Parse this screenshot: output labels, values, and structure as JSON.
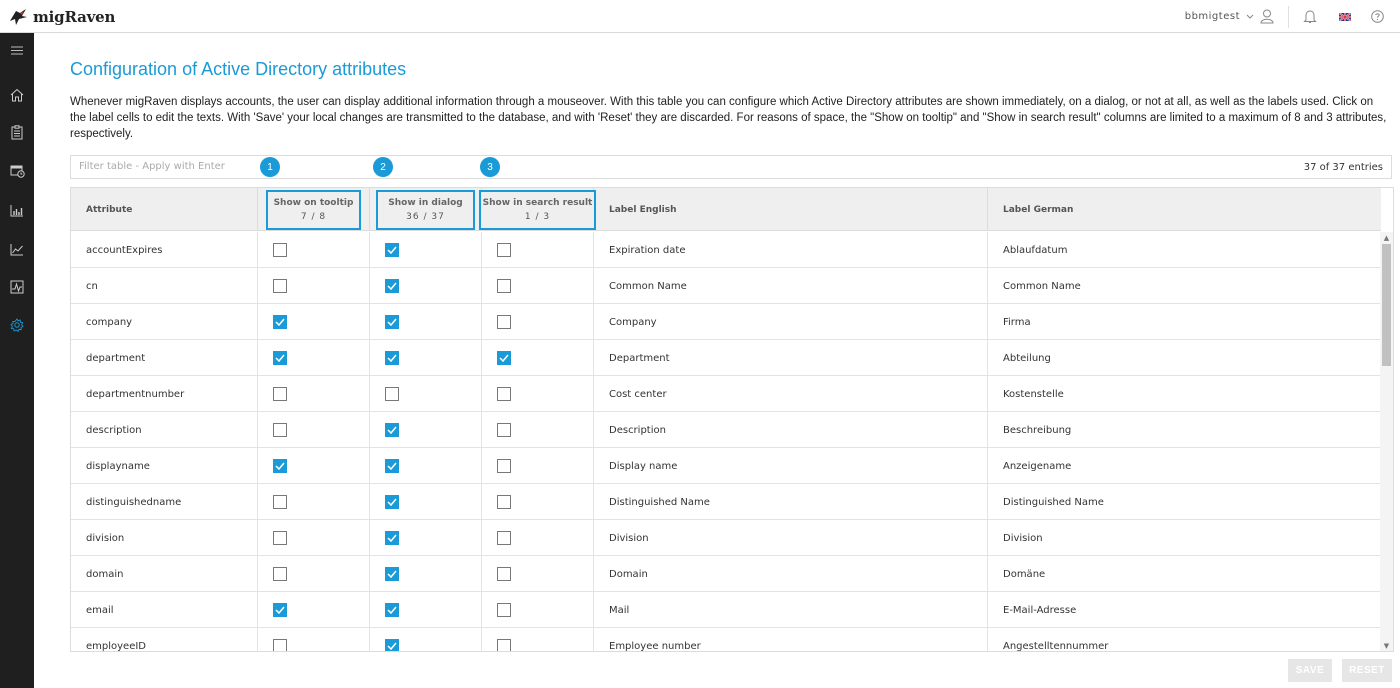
{
  "app": {
    "name": "migRaven"
  },
  "header": {
    "user": "bbmigtest"
  },
  "page": {
    "title": "Configuration of Active Directory attributes",
    "description": "Whenever migRaven displays accounts, the user can display additional information through a mouseover. With this table you can configure which Active Directory attributes are shown immediately, on a dialog, or not at all, as well as the labels used. Click on the label cells to edit the texts. With 'Save' your local changes are transmitted to the database, and with 'Reset' they are discarded. For reasons of space, the \"Show on tooltip\" and \"Show in search result\" columns are limited to a maximum of 8 and 3 attributes, respectively."
  },
  "filter": {
    "placeholder": "Filter table - Apply with Enter",
    "entries": "37 of 37 entries"
  },
  "badges": [
    "1",
    "2",
    "3"
  ],
  "columns": {
    "attribute": "Attribute",
    "tooltip": {
      "label": "Show on tooltip",
      "count": "7 / 8"
    },
    "dialog": {
      "label": "Show in dialog",
      "count": "36 / 37"
    },
    "search": {
      "label": "Show in search result",
      "count": "1 / 3"
    },
    "label_en": "Label English",
    "label_de": "Label German"
  },
  "rows": [
    {
      "attribute": "accountExpires",
      "tooltip": false,
      "dialog": true,
      "search": false,
      "label_en": "Expiration date",
      "label_de": "Ablaufdatum"
    },
    {
      "attribute": "cn",
      "tooltip": false,
      "dialog": true,
      "search": false,
      "label_en": "Common Name",
      "label_de": "Common Name"
    },
    {
      "attribute": "company",
      "tooltip": true,
      "dialog": true,
      "search": false,
      "label_en": "Company",
      "label_de": "Firma"
    },
    {
      "attribute": "department",
      "tooltip": true,
      "dialog": true,
      "search": true,
      "label_en": "Department",
      "label_de": "Abteilung"
    },
    {
      "attribute": "departmentnumber",
      "tooltip": false,
      "dialog": false,
      "search": false,
      "label_en": "Cost center",
      "label_de": "Kostenstelle"
    },
    {
      "attribute": "description",
      "tooltip": false,
      "dialog": true,
      "search": false,
      "label_en": "Description",
      "label_de": "Beschreibung"
    },
    {
      "attribute": "displayname",
      "tooltip": true,
      "dialog": true,
      "search": false,
      "label_en": "Display name",
      "label_de": "Anzeigename"
    },
    {
      "attribute": "distinguishedname",
      "tooltip": false,
      "dialog": true,
      "search": false,
      "label_en": "Distinguished Name",
      "label_de": "Distinguished Name"
    },
    {
      "attribute": "division",
      "tooltip": false,
      "dialog": true,
      "search": false,
      "label_en": "Division",
      "label_de": "Division"
    },
    {
      "attribute": "domain",
      "tooltip": false,
      "dialog": true,
      "search": false,
      "label_en": "Domain",
      "label_de": "Domäne"
    },
    {
      "attribute": "email",
      "tooltip": true,
      "dialog": true,
      "search": false,
      "label_en": "Mail",
      "label_de": "E-Mail-Adresse"
    },
    {
      "attribute": "employeeID",
      "tooltip": false,
      "dialog": true,
      "search": false,
      "label_en": "Employee number",
      "label_de": "Angestelltennummer"
    }
  ],
  "buttons": {
    "save": "SAVE",
    "reset": "RESET"
  },
  "colors": {
    "accent": "#1a9bd7",
    "sidebar": "#1f1f1f"
  },
  "sidebar_icons": [
    "menu-icon",
    "home-icon",
    "clipboard-icon",
    "calendar-clock-icon",
    "bar-chart-icon",
    "line-chart-icon",
    "activity-icon",
    "settings-icon"
  ]
}
